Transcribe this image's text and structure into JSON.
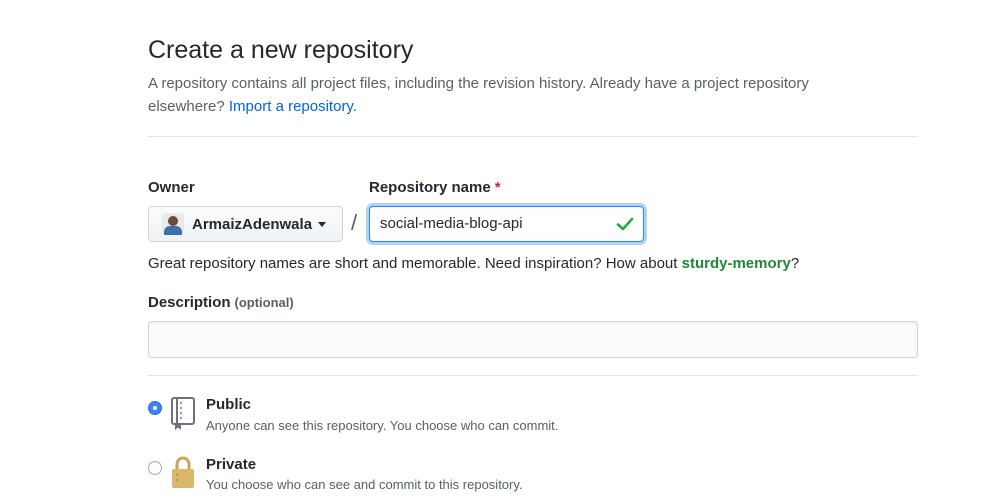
{
  "page": {
    "title": "Create a new repository",
    "subtitle_text": "A repository contains all project files, including the revision history. Already have a project repository elsewhere?",
    "import_link": "Import a repository."
  },
  "owner": {
    "label": "Owner",
    "value": "ArmaizAdenwala"
  },
  "separator": "/",
  "repo_name": {
    "label": "Repository name",
    "required_mark": "*",
    "value": "social-media-blog-api",
    "status_icon": "check-icon"
  },
  "hint": {
    "text": "Great repository names are short and memorable. Need inspiration? How about",
    "suggestion": "sturdy-memory",
    "end": "?"
  },
  "description": {
    "label": "Description",
    "optional": "(optional)",
    "value": "",
    "placeholder": ""
  },
  "visibility": {
    "selected": "public",
    "options": [
      {
        "id": "public",
        "title": "Public",
        "description": "Anyone can see this repository. You choose who can commit.",
        "icon": "repo-book-icon"
      },
      {
        "id": "private",
        "title": "Private",
        "description": "You choose who can see and commit to this repository.",
        "icon": "lock-icon"
      }
    ]
  },
  "colors": {
    "link": "#0366d6",
    "suggestion": "#22863a",
    "required": "#cb2431",
    "focus": "#2188ff",
    "check": "#28a745",
    "radio_selected": "#3b82f6"
  }
}
